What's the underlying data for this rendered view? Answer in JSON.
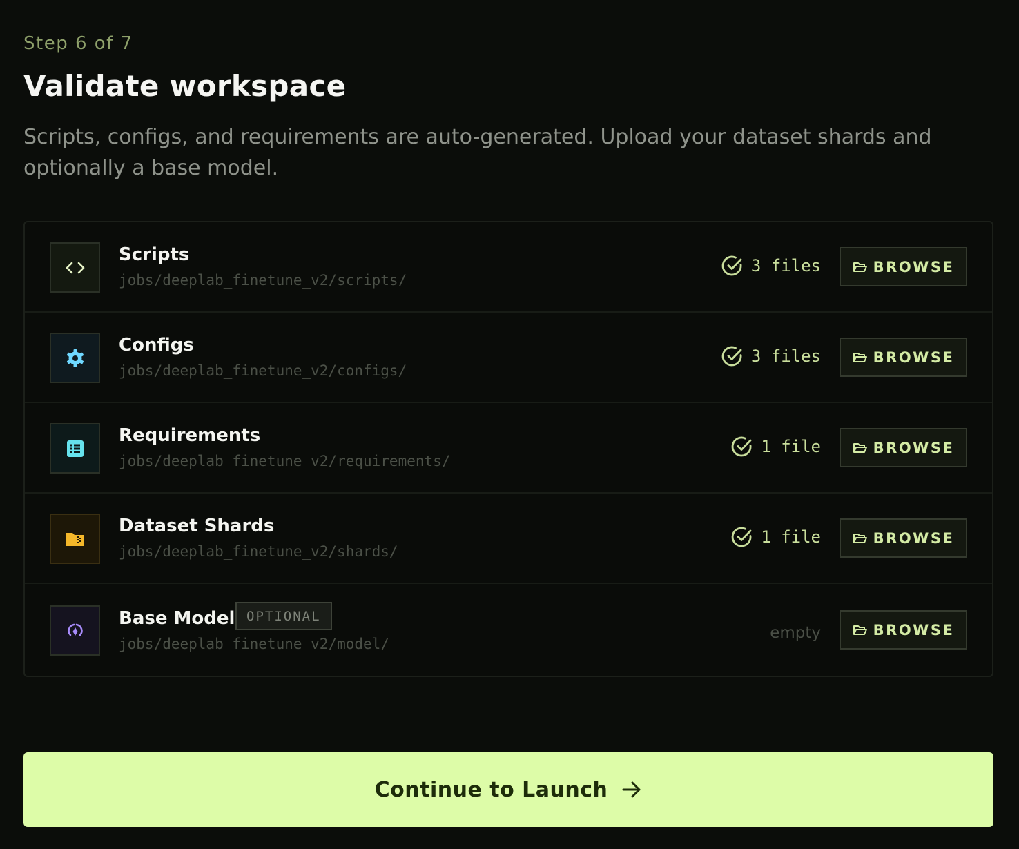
{
  "step_label": "Step 6 of 7",
  "title": "Validate workspace",
  "subtitle": "Scripts, configs, and requirements are auto-generated. Upload your dataset shards and optionally a base model.",
  "rows": [
    {
      "name": "Scripts",
      "path": "jobs/deeplab_finetune_v2/scripts/",
      "status": "3 files",
      "icon": "code-icon",
      "browse": "BROWSE"
    },
    {
      "name": "Configs",
      "path": "jobs/deeplab_finetune_v2/configs/",
      "status": "3 files",
      "icon": "gear-icon",
      "browse": "BROWSE"
    },
    {
      "name": "Requirements",
      "path": "jobs/deeplab_finetune_v2/requirements/",
      "status": "1 file",
      "icon": "list-icon",
      "browse": "BROWSE"
    },
    {
      "name": "Dataset Shards",
      "path": "jobs/deeplab_finetune_v2/shards/",
      "status": "1 file",
      "icon": "archive-folder-icon",
      "browse": "BROWSE"
    },
    {
      "name": "Base Model",
      "badge": "OPTIONAL",
      "path": "jobs/deeplab_finetune_v2/model/",
      "status": "empty",
      "icon": "model-icon",
      "browse": "BROWSE"
    }
  ],
  "continue_label": "Continue to Launch",
  "colors": {
    "accent": "#ddfca8",
    "background": "#0b0d0a",
    "check": "#c9de9c",
    "code_icon": "#e6f3c6",
    "gear_icon": "#6fd8ff",
    "list_icon": "#66e3ee",
    "folder_icon": "#f5b82a",
    "model_icon": "#a78bfa"
  }
}
